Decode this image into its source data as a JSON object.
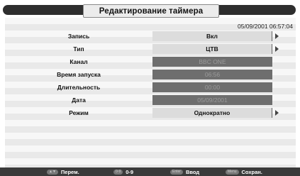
{
  "title": "Редактирование таймера",
  "datetime": "05/09/2001 06:57:04",
  "rows": [
    {
      "label": "Запись",
      "value": "Вкл",
      "state": "active"
    },
    {
      "label": "Тип",
      "value": "ЦТВ",
      "state": "active"
    },
    {
      "label": "Канал",
      "value": "BBC ONE",
      "state": "disabled"
    },
    {
      "label": "Время запуска",
      "value": "06:56",
      "state": "disabled"
    },
    {
      "label": "Длительность",
      "value": "00:00",
      "state": "disabled"
    },
    {
      "label": "Дата",
      "value": "05/09/2001",
      "state": "disabled"
    },
    {
      "label": "Режим",
      "value": "Однократно",
      "state": "active"
    }
  ],
  "footer": {
    "nav": {
      "key": "▲▼",
      "label": "Перем."
    },
    "digits": {
      "key": "0-9",
      "label": "0-9"
    },
    "enter": {
      "key": "Enter",
      "label": "Ввод"
    },
    "menu": {
      "key": "Menu",
      "label": "Сохран."
    }
  },
  "colors": {
    "title_bar": "#2e2e2e",
    "disabled_field": "#6e6e6e",
    "active_field": "#dcdcdc"
  }
}
